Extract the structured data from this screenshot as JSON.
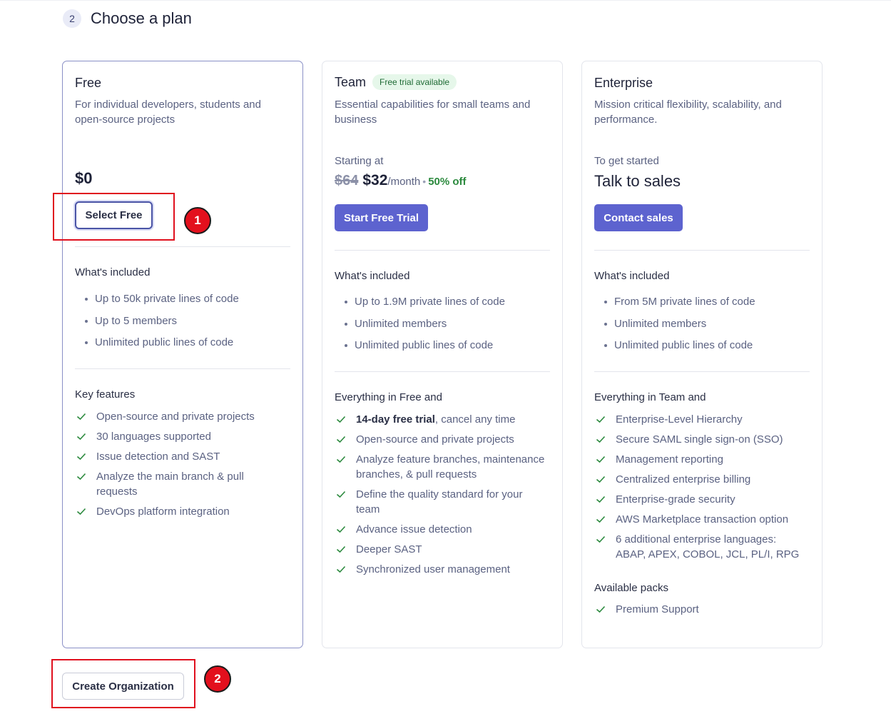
{
  "step": {
    "number": "2",
    "title": "Choose a plan"
  },
  "plans": {
    "free": {
      "name": "Free",
      "description": "For individual developers, students and open-source projects",
      "price": "$0",
      "button": "Select Free",
      "included_title": "What's included",
      "included": [
        "Up to 50k private lines of code",
        "Up to 5 members",
        "Unlimited public lines of code"
      ],
      "features_title": "Key features",
      "features": [
        "Open-source and private projects",
        "30 languages supported",
        "Issue detection and SAST",
        "Analyze the main branch & pull requests",
        "DevOps platform integration"
      ]
    },
    "team": {
      "name": "Team",
      "badge": "Free trial available",
      "description": "Essential capabilities for small teams and business",
      "starting": "Starting at",
      "old_price": "$64",
      "new_price": "$32",
      "per": "/month",
      "sep": "•",
      "discount": "50% off",
      "button": "Start Free Trial",
      "included_title": "What's included",
      "included": [
        "Up to 1.9M private lines of code",
        "Unlimited members",
        "Unlimited public lines of code"
      ],
      "features_title": "Everything in Free and",
      "first_feature_bold": "14-day free trial",
      "first_feature_rest": ", cancel any time",
      "features": [
        "Open-source and private projects",
        "Analyze feature branches, maintenance branches, & pull requests",
        "Define the quality standard for your team",
        "Advance issue detection",
        "Deeper SAST",
        "Synchronized user management"
      ]
    },
    "enterprise": {
      "name": "Enterprise",
      "description": "Mission critical flexibility, scalability, and performance.",
      "starting": "To get started",
      "talk": "Talk to sales",
      "button": "Contact sales",
      "included_title": "What's included",
      "included": [
        "From 5M private lines of code",
        "Unlimited members",
        "Unlimited public lines of code"
      ],
      "features_title": "Everything in Team and",
      "features": [
        "Enterprise-Level Hierarchy",
        "Secure SAML single sign-on (SSO)",
        "Management reporting",
        "Centralized enterprise billing",
        "Enterprise-grade security",
        "AWS Marketplace transaction option",
        "6 additional enterprise languages: ABAP, APEX, COBOL, JCL, PL/I, RPG"
      ],
      "packs_title": "Available packs",
      "packs": [
        "Premium Support"
      ]
    }
  },
  "footer": {
    "create_button": "Create Organization"
  },
  "annotations": {
    "marker1": "1",
    "marker2": "2"
  },
  "colors": {
    "primary": "#5d63cf",
    "check": "#2c8a3e",
    "annotation": "#e0101e"
  }
}
